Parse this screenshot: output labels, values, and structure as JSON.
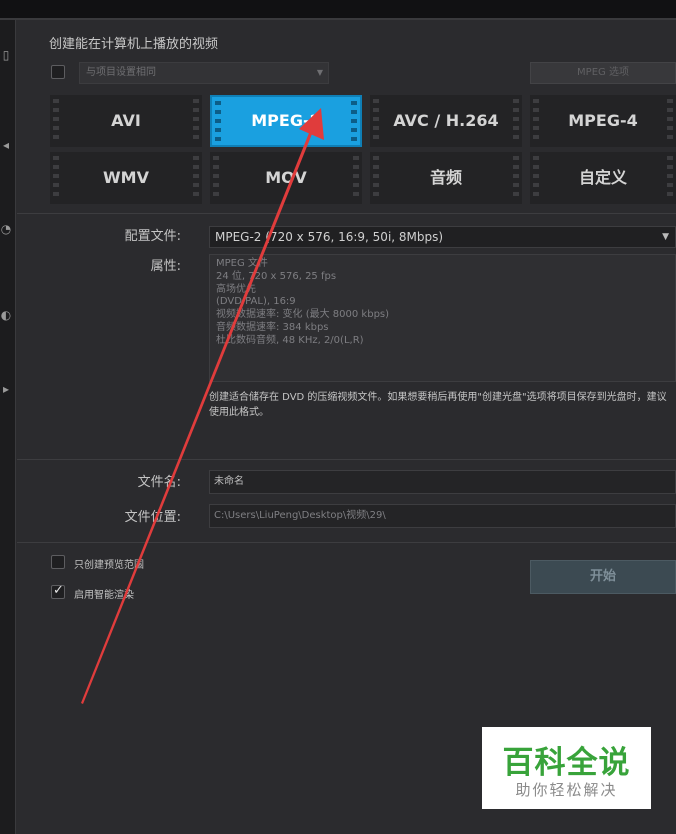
{
  "header": {
    "title": "创建能在计算机上播放的视频"
  },
  "same_as_project": {
    "label": "与项目设置相同",
    "checked": false
  },
  "mpeg_options_label": "MPEG 选项",
  "formats": [
    {
      "label": "AVI",
      "selected": false
    },
    {
      "label": "MPEG-2",
      "selected": true
    },
    {
      "label": "AVC / H.264",
      "selected": false
    },
    {
      "label": "MPEG-4",
      "selected": false
    },
    {
      "label": "WMV",
      "selected": false
    },
    {
      "label": "MOV",
      "selected": false
    },
    {
      "label": "音频",
      "selected": false
    },
    {
      "label": "自定义",
      "selected": false
    }
  ],
  "profile": {
    "label": "配置文件:",
    "value": "MPEG-2 (720 x 576, 16:9, 50i, 8Mbps)"
  },
  "properties": {
    "label": "属性:",
    "lines": [
      "MPEG 文件",
      "24 位, 720 x 576, 25 fps",
      "高场优先",
      "(DVD PAL),  16:9",
      "视频数据速率: 变化 (最大  8000 kbps)",
      "音频数据速率: 384 kbps",
      "杜比数码音频, 48 KHz, 2/0(L,R)"
    ]
  },
  "description": "创建适合储存在 DVD 的压缩视频文件。如果想要稍后再使用\"创建光盘\"选项将项目保存到光盘时，建议使用此格式。",
  "filename": {
    "label": "文件名:",
    "value": "未命名"
  },
  "location": {
    "label": "文件位置:",
    "value": "C:\\Users\\LiuPeng\\Desktop\\视频\\29\\"
  },
  "options": [
    {
      "label": "只创建预览范围",
      "checked": false
    },
    {
      "label": "启用智能渲染",
      "checked": true
    }
  ],
  "start_label": "开始",
  "watermark": {
    "title": "百科全说",
    "subtitle": "助你轻松解决"
  },
  "colors": {
    "accent": "#1aa0e0",
    "annotation_arrow": "#e03c3c",
    "watermark_green": "#38a33a"
  }
}
